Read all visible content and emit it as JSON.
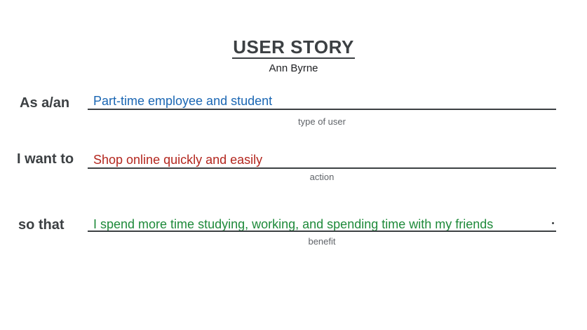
{
  "header": {
    "title": "USER STORY",
    "author": "Ann Byrne"
  },
  "rows": [
    {
      "label": "As a/an",
      "value": "Part-time employee and student",
      "caption": "type of user",
      "color": "#1a66b3"
    },
    {
      "label": "I want to",
      "value": "Shop online quickly and easily",
      "caption": "action",
      "color": "#b3261e"
    },
    {
      "label": "so that",
      "value": "I spend more time studying, working, and spending time with my friends",
      "caption": "benefit",
      "color": "#1e8a3a"
    }
  ]
}
